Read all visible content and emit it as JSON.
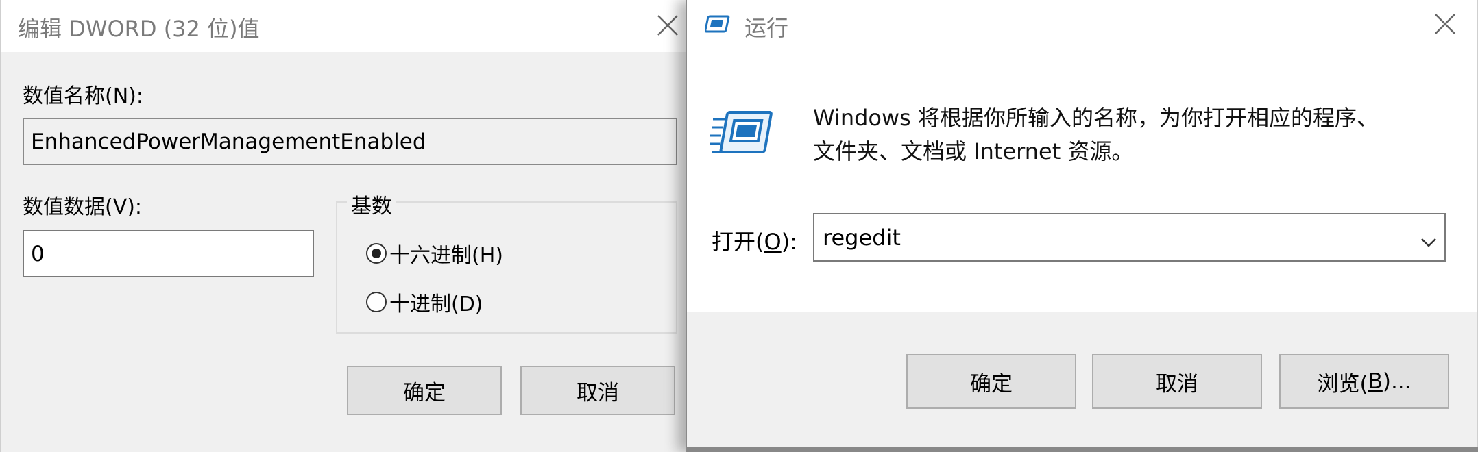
{
  "dword_dialog": {
    "title": "编辑 DWORD (32 位)值",
    "value_name_label": "数值名称(N):",
    "value_name": "EnhancedPowerManagementEnabled",
    "value_data_label": "数值数据(V):",
    "value_data": "0",
    "base_group_label": "基数",
    "radio_hex_label": "十六进制(H)",
    "radio_dec_label": "十进制(D)",
    "radio_selected": "hex",
    "ok_label": "确定",
    "cancel_label": "取消"
  },
  "run_dialog": {
    "title": "运行",
    "description_line1": "Windows 将根据你所输入的名称，为你打开相应的程序、",
    "description_line2": "文件夹、文档或 Internet 资源。",
    "open_label_prefix": "打开(",
    "open_label_accel": "O",
    "open_label_suffix": "):",
    "open_value": "regedit",
    "ok_label": "确定",
    "cancel_label": "取消",
    "browse_label_prefix": "浏览(",
    "browse_label_accel": "B",
    "browse_label_suffix": ")..."
  },
  "icons": {
    "close": "close-icon",
    "run_app": "run-app-icon",
    "dropdown": "chevron-down-icon"
  },
  "colors": {
    "dialog_bg": "#f0f0f0",
    "title_text": "#7a7a7a",
    "button_bg": "#e1e1e1",
    "button_border": "#adadad",
    "run_icon_blue": "#1e73be"
  }
}
